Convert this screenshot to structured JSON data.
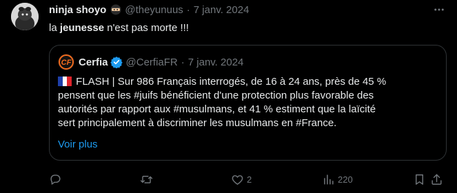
{
  "tweet": {
    "author_name": "ninja shoyo",
    "author_emoji": "ninja-emoji",
    "handle": "@theyunuus",
    "date": "7 janv. 2024",
    "text_prefix": "la ",
    "text_bold": "jeunesse",
    "text_suffix": " n'est pas morte !!!"
  },
  "quote": {
    "author_name": "Cerfia",
    "handle": "@CerfiaFR",
    "date": "7 janv. 2024",
    "lines": [
      "FLASH | Sur 986 Français interrogés, de 16 à 24 ans, près de 45 %",
      "pensent que les #juifs bénéficient d'une protection plus favorable des",
      "autorités par rapport aux #musulmans, et 41 % estiment que la laïcité",
      "sert principalement à discriminer les musulmans en #France."
    ],
    "show_more": "Voir plus",
    "accent_color": "#1d9bf0"
  },
  "actions": {
    "replies": "",
    "retweets": "",
    "likes": "2",
    "views": "220",
    "bookmarks": ""
  },
  "colors": {
    "background": "#000000",
    "text": "#e7e9ea",
    "muted": "#71767b",
    "border": "#2f3336",
    "link": "#1d9bf0"
  }
}
